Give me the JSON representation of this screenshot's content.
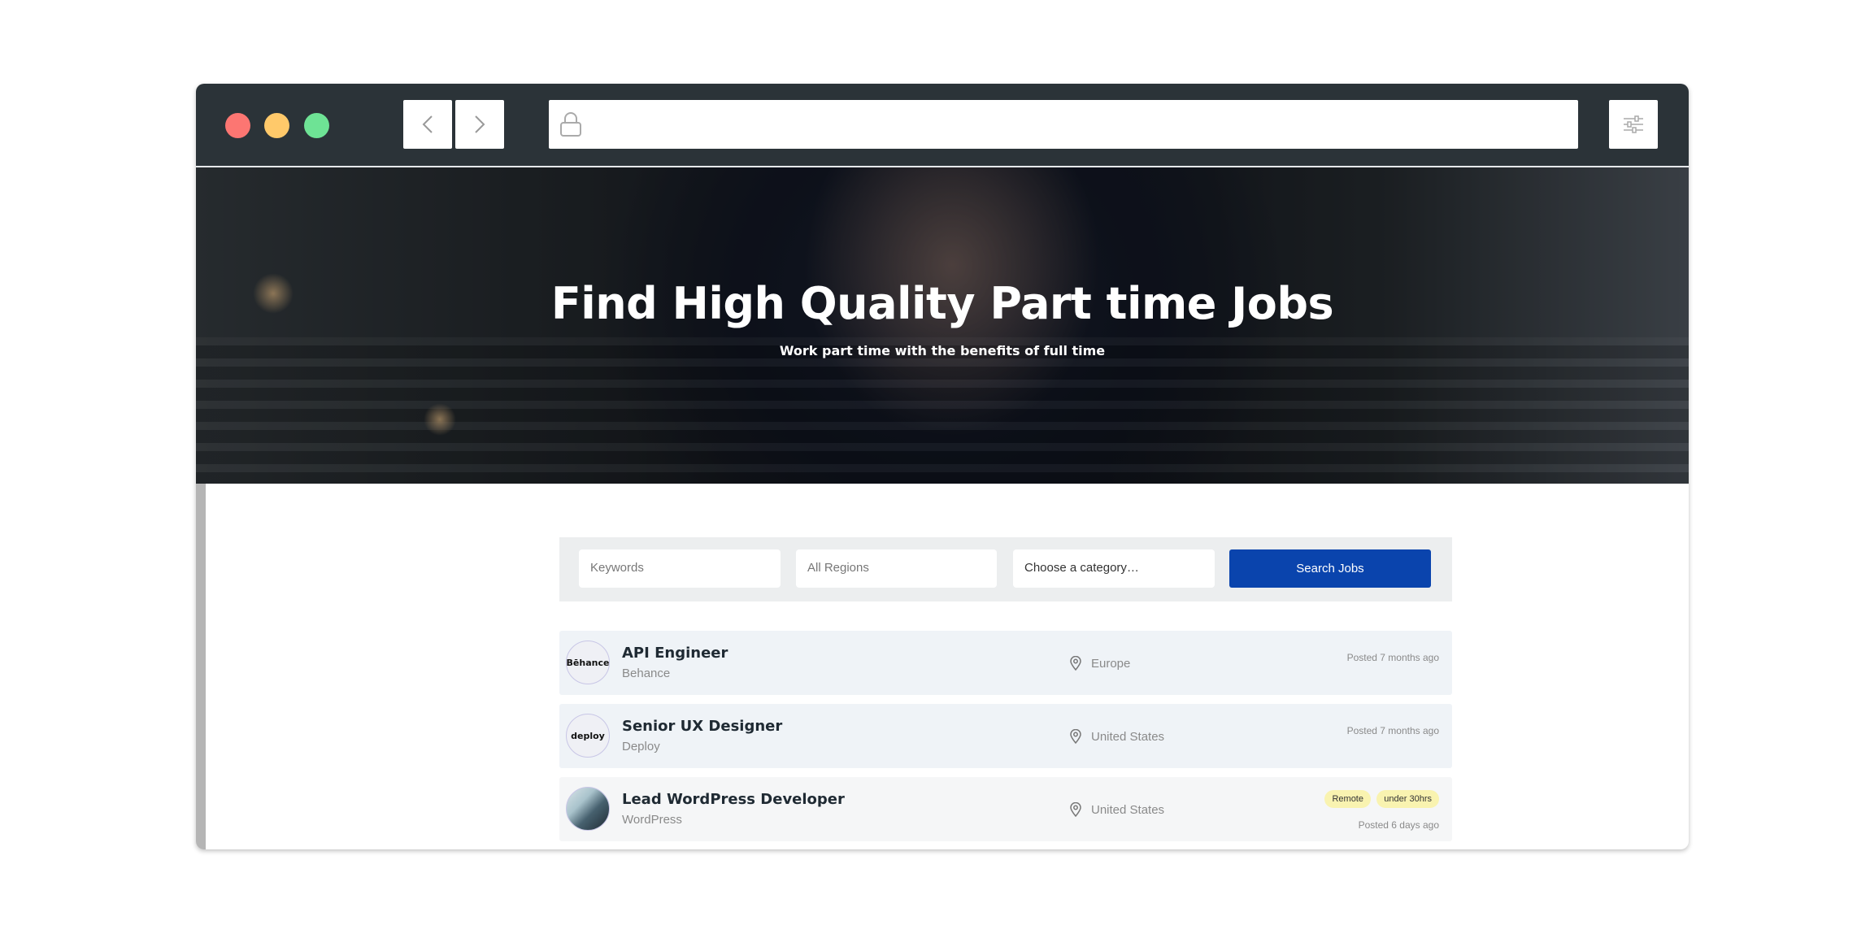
{
  "hero": {
    "title": "Find High Quality Part time Jobs",
    "subtitle": "Work part time with the benefits of full time"
  },
  "search": {
    "keywords_placeholder": "Keywords",
    "regions_value": "All Regions",
    "category_value": "Choose a category…",
    "button_label": "Search Jobs"
  },
  "jobs": [
    {
      "title": "API Engineer",
      "company": "Behance",
      "logo_text": "Bēhance",
      "location": "Europe",
      "posted": "Posted 7 months ago",
      "tags": []
    },
    {
      "title": "Senior UX Designer",
      "company": "Deploy",
      "logo_text": "deploy",
      "location": "United States",
      "posted": "Posted 7 months ago",
      "tags": []
    },
    {
      "title": "Lead WordPress Developer",
      "company": "WordPress",
      "logo_text": "",
      "location": "United States",
      "posted": "Posted 6 days ago",
      "tags": [
        "Remote",
        "under 30hrs"
      ]
    }
  ],
  "colors": {
    "chrome": "#2b3338",
    "accent": "#0a44ad",
    "tag": "#f9f3b0"
  }
}
